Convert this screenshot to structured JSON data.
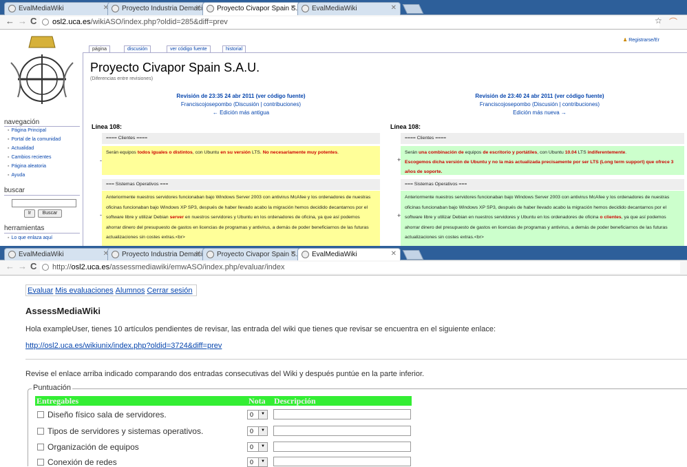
{
  "top_window": {
    "tabs": [
      "EvalMediaWiki",
      "Proyecto Industria Demacio",
      "Proyecto Civapor Spain S.A",
      "EvalMediaWiki"
    ],
    "url": {
      "host": "osl2.uca.es",
      "path": "/wikiASO/index.php?oldid=285&diff=prev"
    },
    "user_link": "Registrarse/Er",
    "page_tabs": [
      "página",
      "discusión",
      "ver código fuente",
      "historial"
    ],
    "title": "Proyecto Civapor Spain S.A.U.",
    "subtitle": "(Diferencias entre revisiones)",
    "sidebar": {
      "nav_heading": "navegación",
      "nav_items": [
        "Página Principal",
        "Portal de la comunidad",
        "Actualidad",
        "Cambios recientes",
        "Página aleatoria",
        "Ayuda"
      ],
      "search_heading": "buscar",
      "search_go": "Ir",
      "search_btn": "Buscar",
      "tools_heading": "herramientas",
      "tools_items": [
        "Lo que enlaza aquí"
      ]
    },
    "left_rev": {
      "title": "Revisión de 23:35 24 abr 2011 (ver código fuente)",
      "author": "Franciscojosepombo",
      "talk": "(Discusión | contribuciones)",
      "nav": "← Edición más antigua"
    },
    "right_rev": {
      "title": "Revisión de 23:40 24 abr 2011 (ver código fuente)",
      "author": "Franciscojosepombo",
      "talk": "(Discusión | contribuciones)",
      "nav": "Edición más nueva →"
    },
    "line_label": "Línea 108:",
    "ctx_clientes": "==== Clientes ====",
    "ctx_sistemas": "=== Sistemas Operativos ===",
    "left_del": {
      "p1": "Serán equipos ",
      "h1": "todos iguales o distintos",
      "p2": ", con Ubuntu ",
      "h2": "en su versión",
      "p3": " LTS. ",
      "h3": "No necesariamente muy potentes",
      "p4": "."
    },
    "right_add": {
      "p1": "Serán ",
      "h1": "una combinación de",
      "p2": " equipos ",
      "h2": "de escritorio y portátiles",
      "p3": ", con Ubuntu ",
      "h3": "10.04",
      "p4": " LTS ",
      "h4": "indiferentemente",
      "p5": ".",
      "line2": "Escogemos dicha versión de Ubuntu y no la más actualizada precisamente por ser LTS (Long term support) que ofrece 3 años de soporte."
    },
    "left_del2": {
      "p1": "Anteriormente nuestros servidores funcionaban bajo Windows Server 2003 con antivirus McAfee y los ordenadores de nuestras oficinas funcionaban bajo Windows XP SP3, después de haber llevado acabo la migración hemos decidido decantarnos por el software libre y utilizar Debian ",
      "h1": "server",
      "p2": " en nuestros servidores y Ubuntu en los ordenadores de oficina, ya que así podemos ahorrar dinero del presupuesto de gastos en licencias de programas y antivirus, a demás de poder beneficiarnos de las futuras actualizaciones sin costes extras.<br>"
    },
    "right_add2": {
      "p1": "Anteriormente nuestros servidores funcionaban bajo Windows Server 2003 con antivirus McAfee y los ordenadores de nuestras oficinas funcionaban bajo Windows XP SP3, después de haber llevado acabo la migración hemos decidido decantarnos por el software libre y utilizar Debian en nuestros servidores y Ubuntu en los ordenadores de oficina ",
      "h1": "o clientes",
      "p2": ", ya que así podemos ahorrar dinero del presupuesto de gastos en licencias de programas y antivirus, a demás de poder beneficiarnos de las futuras actualizaciones sin costes extras.<br>"
    },
    "minus": "-",
    "plus": "+"
  },
  "bottom_window": {
    "tabs": [
      "EvalMediaWiki",
      "Proyecto Industria Demacio",
      "Proyecto Civapor Spain S.A",
      "EvalMediaWiki"
    ],
    "url": {
      "scheme": "http://",
      "host": "osl2.uca.es",
      "path": "/assessmediawiki/emwASO/index.php/evaluar/index"
    },
    "nav_links": [
      "Evaluar",
      "Mis evaluaciones",
      "Alumnos",
      "Cerrar sesión"
    ],
    "heading": "AssessMediaWiki",
    "intro": "Hola exampleUser, tienes 10 artículos pendientes de revisar, las entrada del wiki que tienes que revisar se encuentra en el siguiente enlace:",
    "review_link": "http://osl2.uca.es/wikiunix/index.php?oldid=3724&diff=prev",
    "instructions": "Revise el enlace arriba indicado comparando dos entradas consecutivas del Wiki y después puntúe en la parte inferior.",
    "fieldset_legend": "Puntuación",
    "table_headers": [
      "Entregables",
      "Nota",
      "Descripción"
    ],
    "rows": [
      {
        "label": "Diseño físico sala de servidores.",
        "nota": "0"
      },
      {
        "label": "Tipos de servidores y sistemas operativos.",
        "nota": "0"
      },
      {
        "label": "Organización de equipos",
        "nota": "0"
      },
      {
        "label": "Conexión de redes",
        "nota": "0"
      }
    ]
  },
  "colors": {
    "chrome_frame": "#2d5f9a",
    "diff_deleted": "#ffff99",
    "diff_added": "#ccffcc",
    "diff_changed": "#cc0000",
    "table_header": "#33ee33"
  }
}
